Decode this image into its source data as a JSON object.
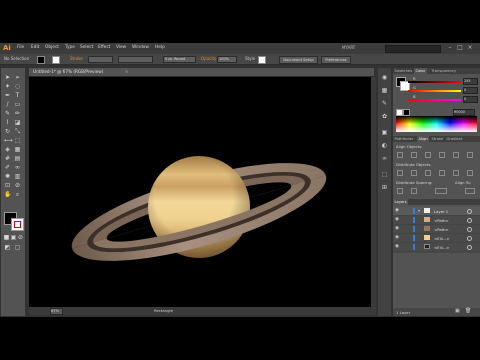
{
  "app": {
    "logo": "Ai",
    "workspace": "MYART"
  },
  "menu": [
    "File",
    "Edit",
    "Object",
    "Type",
    "Select",
    "Effect",
    "View",
    "Window",
    "Help"
  ],
  "control": {
    "selection": "No Selection",
    "stroke_label": "Stroke",
    "brush": "5 pt. Round",
    "opacity_label": "Opacity",
    "opacity_value": "100%",
    "style_label": "Style",
    "doc_setup": "Document Setup",
    "preferences": "Preferences"
  },
  "document": {
    "tab_title": "Untitled-1* @ 67% (RGB/Preview)",
    "close": "×",
    "zoom": "67%",
    "status": "Rectangle"
  },
  "color_panel": {
    "tabs": [
      "Swatches",
      "Color",
      "Transparency"
    ],
    "active_tab": "Color",
    "channels": [
      {
        "label": "R",
        "value": "255"
      },
      {
        "label": "G",
        "value": "0"
      },
      {
        "label": "B",
        "value": "0"
      }
    ],
    "hex": "ff0000"
  },
  "align_panel": {
    "tabs": [
      "Pathfinder",
      "Align",
      "Stroke",
      "Gradient"
    ],
    "active_tab": "Align",
    "align_objects": "Align Objects:",
    "distribute_objects": "Distribute Objects:",
    "distribute_spacing": "Distribute Spacing:",
    "align_to": "Align To:"
  },
  "layers_panel": {
    "tab": "Layers",
    "rows": [
      {
        "label": "Layer 1"
      },
      {
        "label": "<Path>"
      },
      {
        "label": "<Path>"
      },
      {
        "label": "<Elli...>"
      },
      {
        "label": "<Elli...>"
      }
    ],
    "footer": "1 Layer"
  },
  "colors": {
    "ai_orange": "#f79b1f",
    "canvas_bg": "#000000",
    "planet_light": "#f1d28e",
    "planet_dark": "#b88d4e",
    "ring": "#8f7762"
  }
}
